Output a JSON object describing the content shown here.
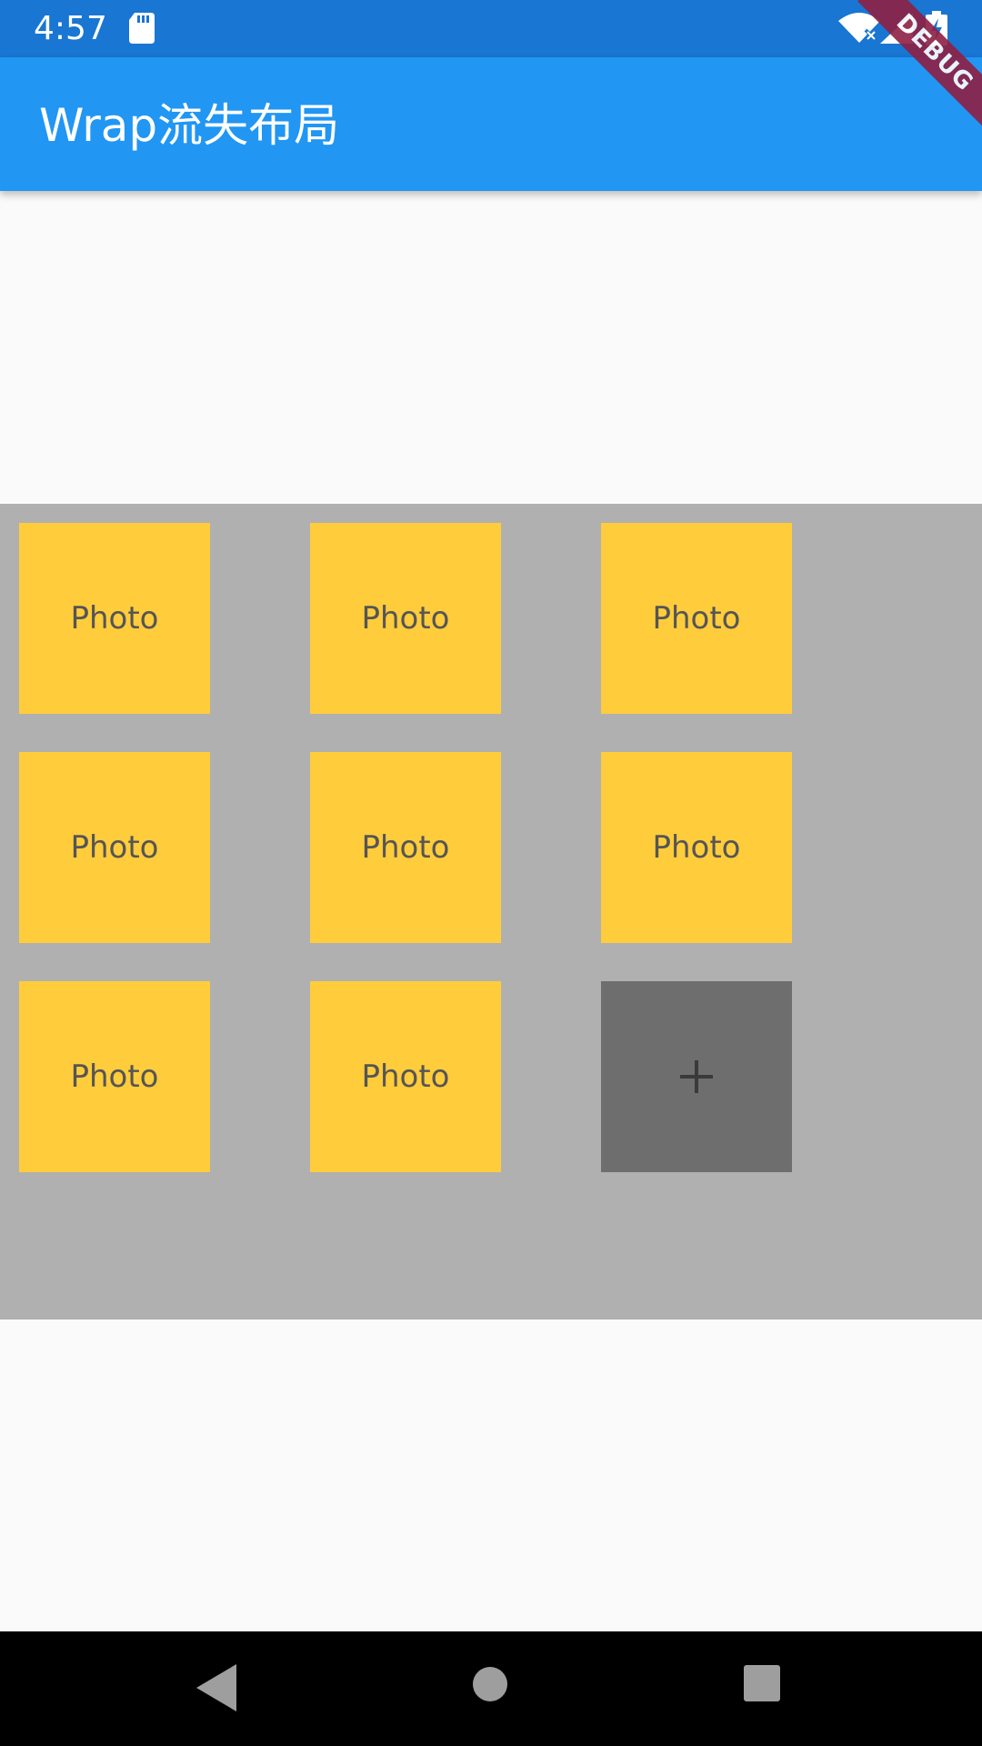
{
  "status_bar": {
    "time": "4:57",
    "bg_color": "#1976d2",
    "icons": [
      "sd-card-icon",
      "wifi-icon",
      "signal-icon",
      "battery-icon"
    ]
  },
  "debug_banner": {
    "label": "DEBUG",
    "color": "#8e2044"
  },
  "app_bar": {
    "title": "Wrap流失布局",
    "bg_color": "#2196f3"
  },
  "wrap": {
    "bg_color": "#b0b0b0",
    "tiles": [
      {
        "label": "Photo"
      },
      {
        "label": "Photo"
      },
      {
        "label": "Photo"
      },
      {
        "label": "Photo"
      },
      {
        "label": "Photo"
      },
      {
        "label": "Photo"
      },
      {
        "label": "Photo"
      },
      {
        "label": "Photo"
      }
    ],
    "tile_color": "#ffcc3b",
    "add_button": {
      "label": "+",
      "icon": "plus-icon",
      "color": "#6e6e6e"
    }
  },
  "nav_bar": {
    "icons": [
      "back-icon",
      "home-icon",
      "recents-icon"
    ]
  }
}
